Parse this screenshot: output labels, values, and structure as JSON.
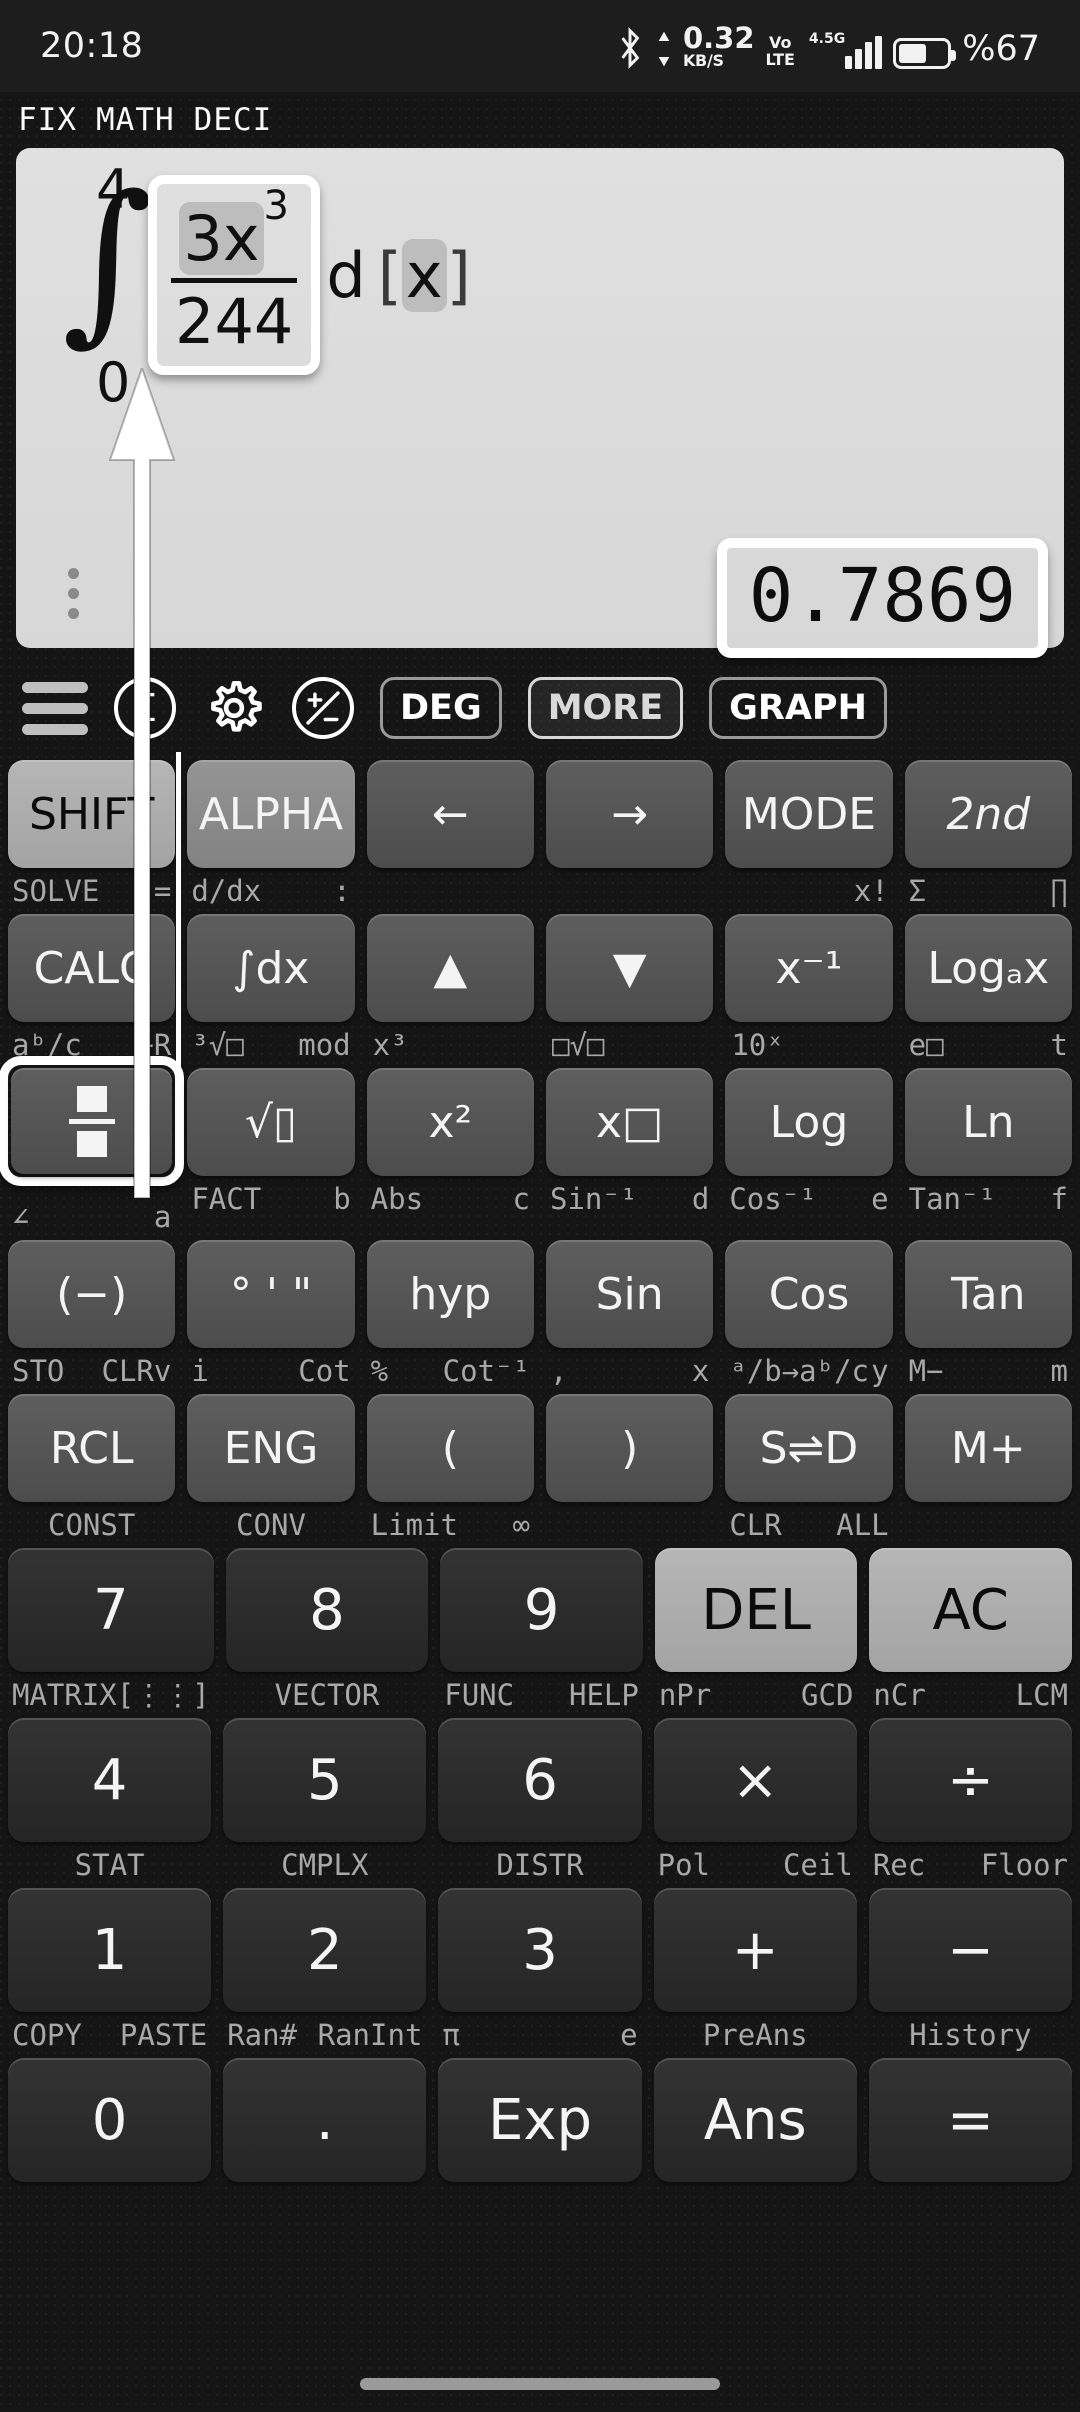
{
  "status_bar": {
    "time": "20:18",
    "net_speed": "0.32",
    "net_unit": "KB/S",
    "volte_top": "Vo",
    "volte_bottom": "LTE",
    "network_gen": "4.5G",
    "battery": "%67",
    "bluetooth_icon": "bluetooth-icon"
  },
  "mode_indicators": [
    "FIX",
    "MATH",
    "DECI"
  ],
  "display": {
    "integral_symbol": "∫",
    "upper_limit": "4",
    "lower_limit": "0",
    "numerator_coeff": "3x",
    "numerator_exponent": "3",
    "denominator": "244",
    "differential": "d",
    "variable_bracket_open": "[",
    "variable": "x",
    "variable_bracket_close": "]",
    "result": "0.7869",
    "overflow_menu": "kebab-menu-icon"
  },
  "toolbar": {
    "menu_icon": "hamburger-menu-icon",
    "sigma_icon": "Σ",
    "gear_icon": "settings-gear-icon",
    "plusminus_icon": "plus-minus-icon",
    "deg": "DEG",
    "more": "MORE",
    "graph": "GRAPH"
  },
  "keypad": {
    "rows": [
      {
        "keys": [
          {
            "label": "SHIFT",
            "style": "shift"
          },
          {
            "label": "ALPHA",
            "style": "alpha"
          },
          {
            "label": "←",
            "style": "fn"
          },
          {
            "label": "→",
            "style": "fn"
          },
          {
            "label": "MODE",
            "style": "fn"
          },
          {
            "label": "2nd",
            "style": "fn-italic"
          }
        ],
        "sublabels": [
          {
            "left": "SOLVE",
            "right": "="
          },
          {
            "left": "d/dx",
            "right": ":"
          },
          {
            "left": "",
            "right": ""
          },
          {
            "left": "",
            "right": ""
          },
          {
            "left": "",
            "right": "x!"
          },
          {
            "left": "Σ",
            "right": "∏"
          }
        ]
      },
      {
        "keys": [
          {
            "label": "CALC",
            "style": "fn"
          },
          {
            "label": "∫dx",
            "style": "fn"
          },
          {
            "label": "▲",
            "style": "fn"
          },
          {
            "label": "▼",
            "style": "fn"
          },
          {
            "label": "x⁻¹",
            "style": "fn"
          },
          {
            "label": "Logₐx",
            "style": "fn"
          }
        ],
        "sublabels": [
          {
            "left": "aᵇ/c",
            "right": "÷R"
          },
          {
            "left": "³√□",
            "right": "mod"
          },
          {
            "left": "x³",
            "right": ""
          },
          {
            "left": "□√□",
            "right": ""
          },
          {
            "left": "10ˣ",
            "right": ""
          },
          {
            "left": "e□",
            "right": "t"
          }
        ]
      },
      {
        "keys": [
          {
            "label": "fraction-icon",
            "style": "fn-selected"
          },
          {
            "label": "√▯",
            "style": "fn"
          },
          {
            "label": "x²",
            "style": "fn"
          },
          {
            "label": "x□",
            "style": "fn"
          },
          {
            "label": "Log",
            "style": "fn"
          },
          {
            "label": "Ln",
            "style": "fn"
          }
        ],
        "sublabels": [
          {
            "left": "∠",
            "right": "a"
          },
          {
            "left": "FACT",
            "right": "b"
          },
          {
            "left": "Abs",
            "right": "c"
          },
          {
            "left": "Sin⁻¹",
            "right": "d"
          },
          {
            "left": "Cos⁻¹",
            "right": "e"
          },
          {
            "left": "Tan⁻¹",
            "right": "f"
          }
        ]
      },
      {
        "keys": [
          {
            "label": "(−)",
            "style": "fn"
          },
          {
            "label": "° ' \"",
            "style": "fn"
          },
          {
            "label": "hyp",
            "style": "fn"
          },
          {
            "label": "Sin",
            "style": "fn"
          },
          {
            "label": "Cos",
            "style": "fn"
          },
          {
            "label": "Tan",
            "style": "fn"
          }
        ],
        "sublabels": [
          {
            "left": "STO",
            "right": "CLRv"
          },
          {
            "left": "i",
            "right": "Cot"
          },
          {
            "left": "%",
            "right": "Cot⁻¹"
          },
          {
            "left": ",",
            "right": "x"
          },
          {
            "left": "ᵃ/b→aᵇ/c",
            "right": "y"
          },
          {
            "left": "M−",
            "right": "m"
          }
        ]
      },
      {
        "keys": [
          {
            "label": "RCL",
            "style": "fn"
          },
          {
            "label": "ENG",
            "style": "fn"
          },
          {
            "label": "(",
            "style": "fn"
          },
          {
            "label": ")",
            "style": "fn"
          },
          {
            "label": "S⇌D",
            "style": "fn"
          },
          {
            "label": "M+",
            "style": "fn"
          }
        ],
        "sublabels": [
          {
            "left": "CONST",
            "right": ""
          },
          {
            "left": "CONV",
            "right": ""
          },
          {
            "left": "Limit",
            "right": "∞"
          },
          {
            "left": "",
            "right": ""
          },
          {
            "left": "CLR",
            "right": "ALL"
          },
          {
            "left": "",
            "right": ""
          }
        ]
      }
    ],
    "numeric_rows": [
      {
        "keys": [
          {
            "label": "7",
            "style": "num"
          },
          {
            "label": "8",
            "style": "num"
          },
          {
            "label": "9",
            "style": "num"
          },
          {
            "label": "DEL",
            "style": "light"
          },
          {
            "label": "AC",
            "style": "light"
          }
        ],
        "sublabels": [
          {
            "left": "MATRIX",
            "right": "[⋮⋮]"
          },
          {
            "left": "VECTOR",
            "right": ""
          },
          {
            "left": "FUNC",
            "right": "HELP"
          },
          {
            "left": "nPr",
            "right": "GCD"
          },
          {
            "left": "nCr",
            "right": "LCM"
          }
        ]
      },
      {
        "keys": [
          {
            "label": "4",
            "style": "num"
          },
          {
            "label": "5",
            "style": "num"
          },
          {
            "label": "6",
            "style": "num"
          },
          {
            "label": "×",
            "style": "num"
          },
          {
            "label": "÷",
            "style": "num"
          }
        ],
        "sublabels": [
          {
            "left": "STAT",
            "right": ""
          },
          {
            "left": "CMPLX",
            "right": ""
          },
          {
            "left": "DISTR",
            "right": ""
          },
          {
            "left": "Pol",
            "right": "Ceil"
          },
          {
            "left": "Rec",
            "right": "Floor"
          }
        ]
      },
      {
        "keys": [
          {
            "label": "1",
            "style": "num"
          },
          {
            "label": "2",
            "style": "num"
          },
          {
            "label": "3",
            "style": "num"
          },
          {
            "label": "+",
            "style": "num"
          },
          {
            "label": "−",
            "style": "num"
          }
        ],
        "sublabels": [
          {
            "left": "COPY",
            "right": "PASTE"
          },
          {
            "left": "Ran#",
            "right": "RanInt"
          },
          {
            "left": "π",
            "right": "e"
          },
          {
            "left": "PreAns",
            "right": ""
          },
          {
            "left": "History",
            "right": ""
          }
        ]
      },
      {
        "keys": [
          {
            "label": "0",
            "style": "num"
          },
          {
            "label": ".",
            "style": "num"
          },
          {
            "label": "Exp",
            "style": "num"
          },
          {
            "label": "Ans",
            "style": "num"
          },
          {
            "label": "=",
            "style": "num"
          }
        ],
        "sublabels": []
      }
    ]
  },
  "annotation": {
    "arrow": "upward-arrow-annotation",
    "highlight_target": "fraction-key",
    "highlight_expression": "fraction-in-expression",
    "highlight_result": "result-value"
  }
}
